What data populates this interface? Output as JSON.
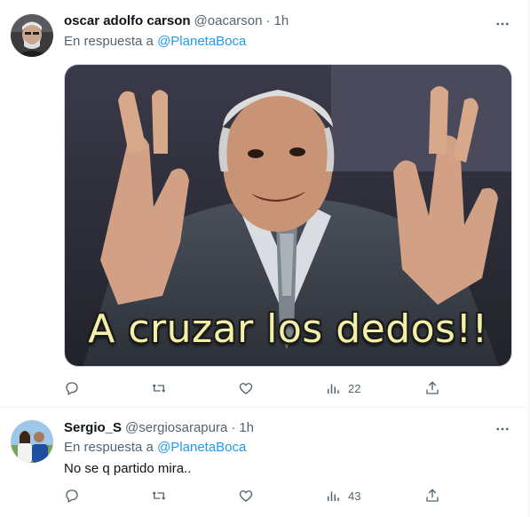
{
  "tweets": [
    {
      "name": "oscar adolfo carson",
      "handle": "@oacarson",
      "dot": "·",
      "time": "1h",
      "reply_prefix": "En respuesta a",
      "reply_to": "@PlanetaBoca",
      "text": "",
      "media_caption": "A cruzar los dedos!!",
      "views": "22"
    },
    {
      "name": "Sergio_S",
      "handle": "@sergiosarapura",
      "dot": "·",
      "time": "1h",
      "reply_prefix": "En respuesta a",
      "reply_to": "@PlanetaBoca",
      "text": "No se q partido mira..",
      "views": "43"
    }
  ],
  "icons": {
    "reply": "reply-icon",
    "retweet": "retweet-icon",
    "like": "heart-icon",
    "views": "views-icon",
    "share": "share-icon",
    "more": "more-icon"
  },
  "colors": {
    "accent": "#1d9bf0",
    "secondary_text": "#536471",
    "divider": "#eff3f4"
  }
}
